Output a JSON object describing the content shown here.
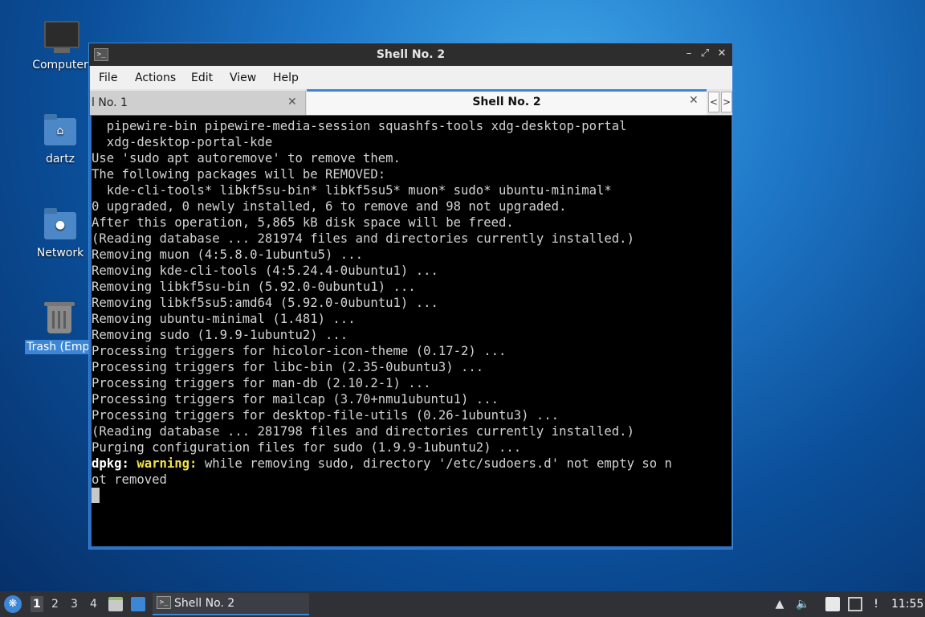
{
  "desktop": {
    "icons": [
      {
        "label": "Computer"
      },
      {
        "label": "dartz"
      },
      {
        "label": "Network"
      },
      {
        "label": "Trash (Empt"
      }
    ]
  },
  "window": {
    "title": "Shell No. 2",
    "controls": {
      "minimize": "–",
      "maximize": "⤢",
      "close": "✕"
    },
    "menu": [
      "File",
      "Actions",
      "Edit",
      "View",
      "Help"
    ],
    "tabs": [
      {
        "label": "l No. 1",
        "close": "✕"
      },
      {
        "label": "Shell No. 2",
        "close": "✕"
      }
    ],
    "tab_nav": {
      "prev": "<",
      "next": ">"
    }
  },
  "terminal": {
    "lines": [
      "  pipewire-bin pipewire-media-session squashfs-tools xdg-desktop-portal",
      "  xdg-desktop-portal-kde",
      "Use 'sudo apt autoremove' to remove them.",
      "The following packages will be REMOVED:",
      "  kde-cli-tools* libkf5su-bin* libkf5su5* muon* sudo* ubuntu-minimal*",
      "0 upgraded, 0 newly installed, 6 to remove and 98 not upgraded.",
      "After this operation, 5,865 kB disk space will be freed.",
      "(Reading database ... 281974 files and directories currently installed.)",
      "Removing muon (4:5.8.0-1ubuntu5) ...",
      "Removing kde-cli-tools (4:5.24.4-0ubuntu1) ...",
      "Removing libkf5su-bin (5.92.0-0ubuntu1) ...",
      "Removing libkf5su5:amd64 (5.92.0-0ubuntu1) ...",
      "Removing ubuntu-minimal (1.481) ...",
      "Removing sudo (1.9.9-1ubuntu2) ...",
      "Processing triggers for hicolor-icon-theme (0.17-2) ...",
      "Processing triggers for libc-bin (2.35-0ubuntu3) ...",
      "Processing triggers for man-db (2.10.2-1) ...",
      "Processing triggers for mailcap (3.70+nmu1ubuntu1) ...",
      "Processing triggers for desktop-file-utils (0.26-1ubuntu3) ...",
      "(Reading database ... 281798 files and directories currently installed.)",
      "Purging configuration files for sudo (1.9.9-1ubuntu2) ..."
    ],
    "warning": {
      "prefix": "dpkg:",
      "keyword": "warning:",
      "message": " while removing sudo, directory '/etc/sudoers.d' not empty so n",
      "continuation": "ot removed"
    }
  },
  "taskbar": {
    "workspaces": [
      "1",
      "2",
      "3",
      "4"
    ],
    "active_workspace": "1",
    "task": {
      "label": "Shell No. 2"
    },
    "clock": "11:55"
  }
}
